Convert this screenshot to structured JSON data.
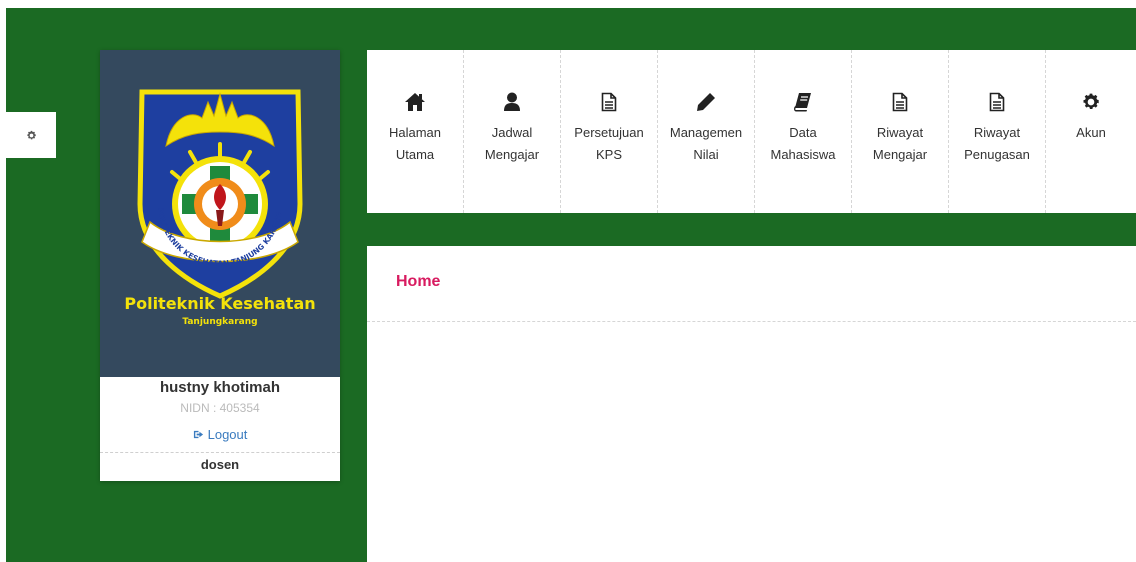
{
  "nav": {
    "items": [
      {
        "label": "Halaman\nUtama",
        "icon": "home-icon"
      },
      {
        "label": "Jadwal\nMengajar",
        "icon": "user-icon"
      },
      {
        "label": "Persetujuan\nKPS",
        "icon": "document-icon"
      },
      {
        "label": "Managemen\nNilai",
        "icon": "pencil-icon"
      },
      {
        "label": "Data\nMahasiswa",
        "icon": "book-icon"
      },
      {
        "label": "Riwayat\nMengajar",
        "icon": "document-icon"
      },
      {
        "label": "Riwayat\nPenugasan",
        "icon": "document-icon"
      },
      {
        "label": "Akun",
        "icon": "gear-icon"
      }
    ]
  },
  "profile": {
    "campus_name": "Politeknik Kesehatan",
    "campus_sub": "Tanjungkarang",
    "crest_text": "POLITEKNIK KESEHATAN TANJUNG KARANG",
    "name": "hustny khotimah",
    "nidn": "NIDN : 405354",
    "logout_label": "Logout",
    "role": "dosen"
  },
  "content": {
    "title": "Home"
  },
  "colors": {
    "green": "#1b6a23",
    "card_dark": "#34495e",
    "title": "#d81b60",
    "link": "#3a7bbf",
    "campus_text": "#f4e20a"
  }
}
